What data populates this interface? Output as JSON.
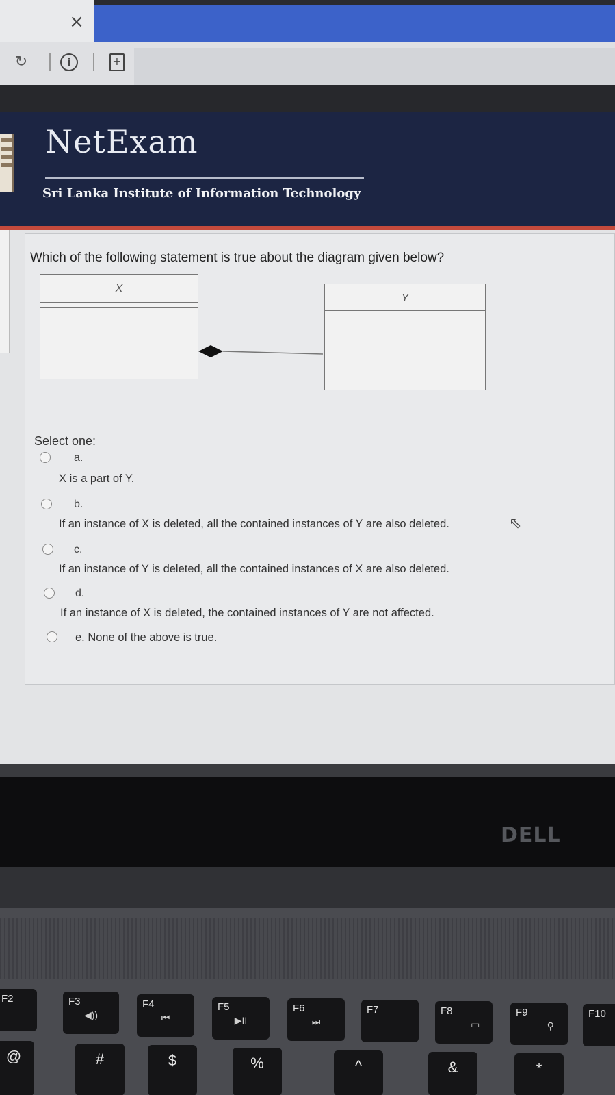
{
  "browser": {
    "tab_close": "×",
    "refresh_icon": "↻",
    "info_icon": "i",
    "page_icon": "+"
  },
  "banner": {
    "logo": "NetExam",
    "subtitle": "Sri Lanka Institute of Information Technology"
  },
  "question": {
    "text": "Which of the following statement is true about the diagram given below?",
    "diagram": {
      "class_left": "X",
      "class_right": "Y",
      "relation": "composition"
    },
    "select_label": "Select one:",
    "options": [
      {
        "letter": "a.",
        "text": "X is a part of Y."
      },
      {
        "letter": "b.",
        "text": "If an instance of X is deleted, all the contained instances of Y are also deleted."
      },
      {
        "letter": "c.",
        "text": "If an instance of Y is deleted, all the contained instances of X are also deleted."
      },
      {
        "letter": "d.",
        "text": "If an instance of X is deleted, the contained instances of Y are not affected."
      },
      {
        "letter": "",
        "text": "e. None of the above is true."
      }
    ]
  },
  "laptop": {
    "brand": "DELL",
    "fkeys": [
      {
        "label": "F2",
        "icon": ""
      },
      {
        "label": "F3",
        "icon": "◀))"
      },
      {
        "label": "F4",
        "icon": "⏮"
      },
      {
        "label": "F5",
        "icon": "▶II"
      },
      {
        "label": "F6",
        "icon": "⏭"
      },
      {
        "label": "F7",
        "icon": ""
      },
      {
        "label": "F8",
        "icon": "▭"
      },
      {
        "label": "F9",
        "icon": "⚲"
      },
      {
        "label": "F10",
        "icon": ""
      }
    ],
    "numkeys": [
      "@",
      "#",
      "$",
      "%",
      "^",
      "&",
      "*"
    ]
  }
}
